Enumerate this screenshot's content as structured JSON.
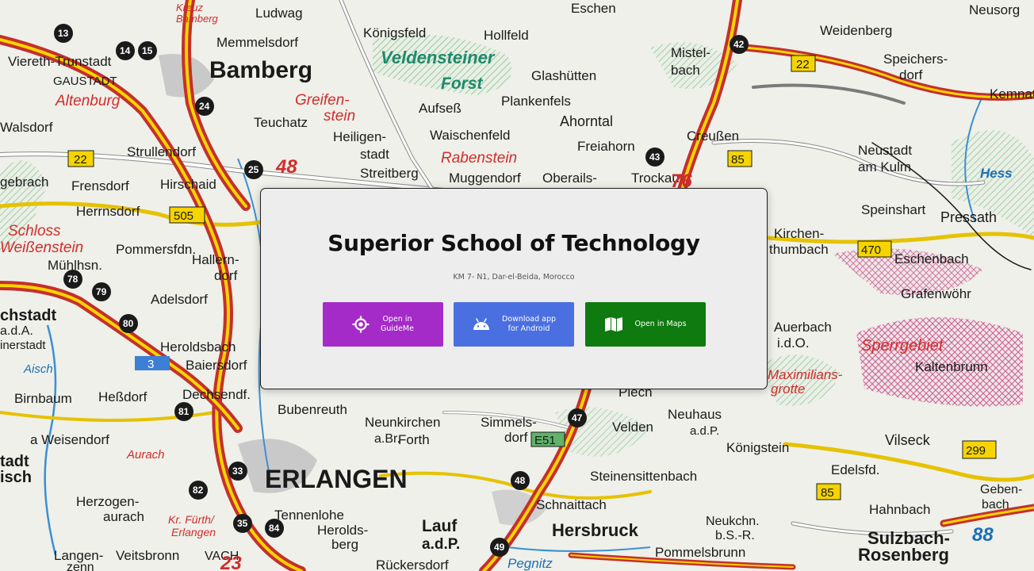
{
  "card": {
    "title": "Superior School of Technology",
    "address": "KM 7- N1, Dar-el-Beida, Morocco"
  },
  "buttons": {
    "guideme": {
      "label": "Open in\nGuideMe",
      "icon": "crosshair-icon",
      "color": "#a42bc8"
    },
    "android": {
      "label": "Download app\nfor Android",
      "icon": "android-icon",
      "color": "#4a6fe0"
    },
    "maps": {
      "label": "Open in Maps",
      "icon": "map-icon",
      "color": "#0f7a0f"
    }
  },
  "background_map": {
    "places": [
      "Kreuz Bamberg",
      "Ludwag",
      "Königsfeld",
      "Hollfeld",
      "Eschen",
      "Neusorg",
      "Weidenberg",
      "Viereth-Trunstadt",
      "Memmelsdorf",
      "Bamberg",
      "Veldensteiner Forst",
      "Mistel-bach",
      "Speichers-dorf",
      "GAUSTADT",
      "Glashütten",
      "Kemnath",
      "Altenburg",
      "Greifen-stein",
      "Aufseß",
      "Plankenfels",
      "Walsdorf",
      "Teuchatz",
      "Heiligen-stadt",
      "Waischenfeld",
      "Ahorntal",
      "Creußen",
      "Neustadt am Kulm",
      "Strullendorf",
      "Freiahorn",
      "Rabenstein",
      "Frensdorf",
      "Hirschaid",
      "Streitberg",
      "Muggendorf",
      "Oberails-",
      "Trockau",
      "Herrnsdorf",
      "Speinshart",
      "Pressath",
      "Schloss Weißenstein",
      "Pommersfdn.",
      "Kirchen-thumbach",
      "Eschenbach",
      "Mühlhsn.",
      "Hallern-dorf",
      "Grafenwöhr",
      "Adelsdorf",
      "Heroldsbach",
      "Auerbach i.d.O.",
      "Sperrgebiet",
      "Baiersdorf",
      "Kaltenbrunn",
      "Birnbaum",
      "Heßdorf",
      "Dechsendf.",
      "Maximilians-grotte",
      "Bubenreuth",
      "Neunkirchen a.Br.",
      "Simmels-dorf",
      "Plech",
      "Velden",
      "Neuhaus a.d.P.",
      "Königstein",
      "Vilseck",
      "Weisendorf",
      "Forth",
      "Edelsfd.",
      "Aurach",
      "ERLANGEN",
      "Steinensittenbach",
      "Herzogen-aurach",
      "Schnaittach",
      "Geben-bach",
      "Hahnbach",
      "Kr. Fürth/Erlangen",
      "Tennenlohe",
      "Herolds-berg",
      "Lauf a.d.P.",
      "Hersbruck",
      "Neukchn. b.S.-R.",
      "Sulzbach-Rosenberg",
      "Langen-zenn",
      "Veitsbronn",
      "Rückersdorf",
      "Pegnitz",
      "Pommelsbrunn"
    ],
    "route_numbers": [
      "13",
      "14",
      "15",
      "24",
      "25",
      "42",
      "43",
      "47",
      "48",
      "49",
      "78",
      "79",
      "80",
      "81",
      "82",
      "33",
      "35",
      "84"
    ],
    "road_labels": [
      "22",
      "505",
      "85",
      "470",
      "E51",
      "3",
      "299",
      "85",
      "88",
      "76",
      "48",
      "23"
    ]
  }
}
